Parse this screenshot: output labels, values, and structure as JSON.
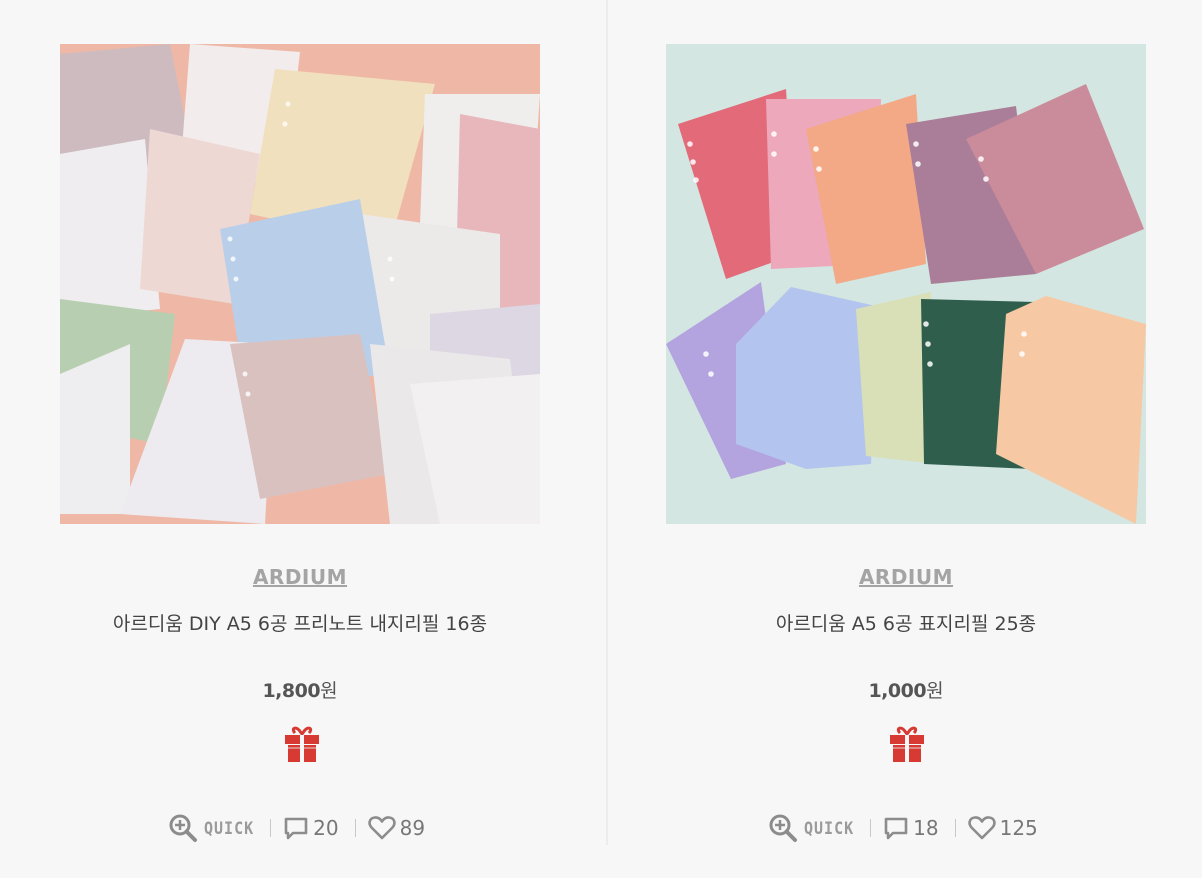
{
  "products": [
    {
      "brand": "ARDIUM",
      "name": "아르디움 DIY A5 6공 프리노트 내지리필 16종",
      "price": "1,800",
      "currency": "원",
      "quick_label": "QUICK",
      "reviews": "20",
      "likes": "89",
      "image_icon": "pastel-paper-refills-photo"
    },
    {
      "brand": "ARDIUM",
      "name": "아르디움 A5 6공 표지리필 25종",
      "price": "1,000",
      "currency": "원",
      "quick_label": "QUICK",
      "reviews": "18",
      "likes": "125",
      "image_icon": "colored-cover-refills-photo"
    }
  ],
  "colors": {
    "background": "#f7f7f7",
    "brand_text": "#a4a4a4",
    "gift_icon": "#d63a33",
    "meta_text": "#7a7a7a"
  }
}
